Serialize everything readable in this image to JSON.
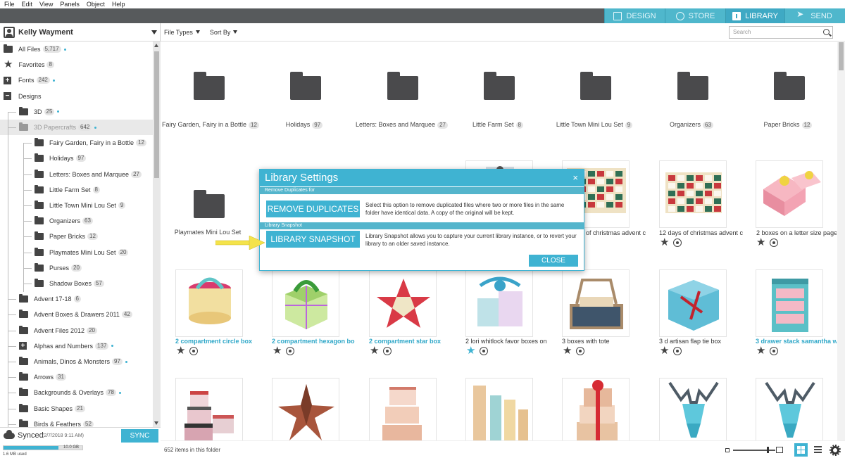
{
  "menu": [
    "File",
    "Edit",
    "View",
    "Panels",
    "Object",
    "Help"
  ],
  "tabs": [
    {
      "label": "DESIGN",
      "icon": "design-icon"
    },
    {
      "label": "STORE",
      "icon": "store-icon"
    },
    {
      "label": "LIBRARY",
      "icon": "library-icon",
      "active": true
    },
    {
      "label": "SEND",
      "icon": "send-icon"
    }
  ],
  "user": {
    "name": "Kelly Wayment"
  },
  "toolbar": {
    "file_types": "File Types",
    "sort_by": "Sort By",
    "search_placeholder": "Search"
  },
  "sidebar": {
    "items": [
      {
        "label": "All Files",
        "count": "5,717",
        "dot": true,
        "icon": "folder"
      },
      {
        "label": "Favorites",
        "count": "8",
        "icon": "star"
      },
      {
        "label": "Fonts",
        "count": "242",
        "dot": true,
        "icon": "plus"
      },
      {
        "label": "Designs",
        "icon": "minus"
      },
      {
        "label": "3D",
        "count": "25",
        "dot": true,
        "icon": "folder"
      },
      {
        "label": "3D Papercrafts",
        "count": "642",
        "dot": true,
        "icon": "minusfolder",
        "selected": true
      },
      {
        "label": "Fairy Garden, Fairy in a Bottle",
        "count": "12",
        "icon": "folder"
      },
      {
        "label": "Holidays",
        "count": "97",
        "icon": "folder"
      },
      {
        "label": "Letters: Boxes and Marquee",
        "count": "27",
        "icon": "folder"
      },
      {
        "label": "Little Farm Set",
        "count": "8",
        "icon": "folder"
      },
      {
        "label": "Little Town Mini Lou Set",
        "count": "9",
        "icon": "folder"
      },
      {
        "label": "Organizers",
        "count": "63",
        "icon": "folder"
      },
      {
        "label": "Paper Bricks",
        "count": "12",
        "icon": "folder"
      },
      {
        "label": "Playmates Mini Lou Set",
        "count": "20",
        "icon": "folder"
      },
      {
        "label": "Purses",
        "count": "20",
        "icon": "folder"
      },
      {
        "label": "Shadow Boxes",
        "count": "57",
        "icon": "folder"
      },
      {
        "label": "Advent 17-18",
        "count": "6",
        "icon": "folder"
      },
      {
        "label": "Advent Boxes & Drawers 2011",
        "count": "42",
        "icon": "folder"
      },
      {
        "label": "Advent Files 2012",
        "count": "20",
        "icon": "folder"
      },
      {
        "label": "Alphas and Numbers",
        "count": "137",
        "dot": true,
        "icon": "plusfolder"
      },
      {
        "label": "Animals, Dinos & Monsters",
        "count": "97",
        "dot": true,
        "icon": "folder"
      },
      {
        "label": "Arrows",
        "count": "31",
        "icon": "folder"
      },
      {
        "label": "Backgrounds & Overlays",
        "count": "78",
        "dot": true,
        "icon": "folder"
      },
      {
        "label": "Basic Shapes",
        "count": "21",
        "icon": "folder"
      },
      {
        "label": "Birds & Feathers",
        "count": "52",
        "icon": "folder"
      }
    ]
  },
  "sync": {
    "status": "Synced",
    "date": "(2/7/2018 9:11 AM)",
    "button": "SYNC",
    "storage_total": "10.0 GB",
    "used": "1.6 MB used",
    "fill_fraction": 0.7
  },
  "folders": [
    {
      "label": "Fairy Garden, Fairy in a Bottle",
      "count": "12"
    },
    {
      "label": "Holidays",
      "count": "97"
    },
    {
      "label": "Letters: Boxes and Marquee",
      "count": "27"
    },
    {
      "label": "Little Farm Set",
      "count": "8"
    },
    {
      "label": "Little Town Mini Lou Set",
      "count": "9"
    },
    {
      "label": "Organizers",
      "count": "63"
    },
    {
      "label": "Paper Bricks",
      "count": "12"
    },
    {
      "label": "Playmates Mini Lou Set",
      "count": ""
    }
  ],
  "items_row2": [
    {
      "label": "12 days of christmas advent c",
      "highlight": false
    },
    {
      "label": "12 days of christmas advent c",
      "highlight": false
    },
    {
      "label": "2 boxes on a letter size page",
      "highlight": false
    }
  ],
  "items_row3": [
    {
      "label": "2 compartment circle box",
      "highlight": true
    },
    {
      "label": "2 compartment hexagon bo",
      "highlight": true
    },
    {
      "label": "2 compartment star box",
      "highlight": true
    },
    {
      "label": "2 lori whitlock favor boxes on",
      "highlight": false,
      "fav": true
    },
    {
      "label": "3 boxes with tote",
      "highlight": false
    },
    {
      "label": "3 d artisan flap tie box",
      "highlight": false
    },
    {
      "label": "3 drawer stack samantha w",
      "highlight": true
    }
  ],
  "status": {
    "count": "652 items in this folder"
  },
  "dialog": {
    "title": "Library Settings",
    "close": "×",
    "section1": "Remove Duplicates for",
    "btn1": "REMOVE DUPLICATES",
    "desc1": "Select this option to remove duplicated files where two or more files in the same folder have identical data. A copy of the original will be kept.",
    "section2": "Library Snapshot",
    "btn2": "LIBRARY SNAPSHOT",
    "desc2": "Library Snapshot allows you to capture your current library instance, or to revert your library to an older saved instance.",
    "close_button": "CLOSE"
  },
  "colors": {
    "accent": "#3fb3d2",
    "tabbar": "#575a5c",
    "arrow": "#f4e34a"
  }
}
